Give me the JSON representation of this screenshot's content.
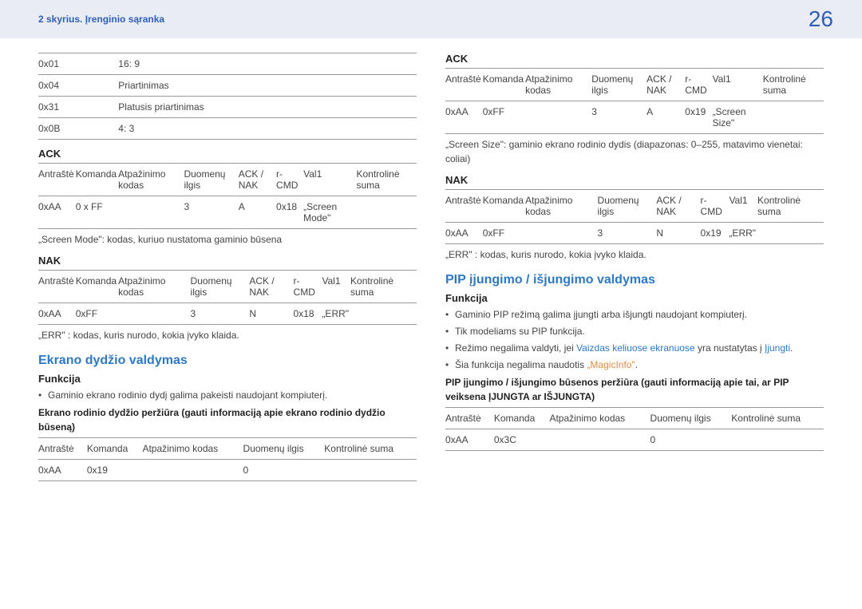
{
  "header": {
    "chapter": "2 skyrius. Įrenginio sąranka",
    "page": "26"
  },
  "left": {
    "modes_table": {
      "rows": [
        [
          "0x01",
          "16: 9"
        ],
        [
          "0x04",
          "Priartinimas"
        ],
        [
          "0x31",
          "Platusis priartinimas"
        ],
        [
          "0x0B",
          "4: 3"
        ]
      ]
    },
    "ack_heading": "ACK",
    "ack_table": {
      "head": [
        "Antraštė",
        "Komanda",
        "Atpažinimo kodas",
        "Duomenų ilgis",
        "ACK / NAK",
        "r-CMD",
        "Val1",
        "Kontrolinė suma"
      ],
      "row": [
        "0xAA",
        "0 x FF",
        "",
        "3",
        "A",
        "0x18",
        "„Screen Mode\"",
        ""
      ]
    },
    "screen_mode_text": "„Screen Mode\": kodas, kuriuo nustatoma gaminio būsena",
    "nak_heading": "NAK",
    "nak_table": {
      "head": [
        "Antraštė",
        "Komanda",
        "Atpažinimo kodas",
        "Duomenų ilgis",
        "ACK / NAK",
        "r-CMD",
        "Val1",
        "Kontrolinė suma"
      ],
      "row": [
        "0xAA",
        "0xFF",
        "",
        "3",
        "N",
        "0x18",
        "„ERR\"",
        ""
      ]
    },
    "err_text": "„ERR\" : kodas, kuris nurodo, kokia įvyko klaida.",
    "section_heading": "Ekrano dydžio valdymas",
    "func_heading": "Funkcija",
    "func_bullet": "Gaminio ekrano rodinio dydį galima pakeisti naudojant kompiuterį.",
    "view_text": "Ekrano rodinio dydžio peržiūra (gauti informaciją apie ekrano rodinio dydžio būseną)",
    "view_table": {
      "head": [
        "Antraštė",
        "Komanda",
        "Atpažinimo kodas",
        "Duomenų ilgis",
        "Kontrolinė suma"
      ],
      "row": [
        "0xAA",
        "0x19",
        "",
        "0",
        ""
      ]
    }
  },
  "right": {
    "ack_heading": "ACK",
    "ack_table": {
      "head": [
        "Antraštė",
        "Komanda",
        "Atpažinimo kodas",
        "Duomenų ilgis",
        "ACK / NAK",
        "r-CMD",
        "Val1",
        "Kontrolinė suma"
      ],
      "row": [
        "0xAA",
        "0xFF",
        "",
        "3",
        "A",
        "0x19",
        "„Screen Size\"",
        ""
      ]
    },
    "screen_size_text": "„Screen Size\": gaminio ekrano rodinio dydis (diapazonas: 0–255, matavimo vienetai: coliai)",
    "nak_heading": "NAK",
    "nak_table": {
      "head": [
        "Antraštė",
        "Komanda",
        "Atpažinimo kodas",
        "Duomenų ilgis",
        "ACK / NAK",
        "r-CMD",
        "Val1",
        "Kontrolinė suma"
      ],
      "row": [
        "0xAA",
        "0xFF",
        "",
        "3",
        "N",
        "0x19",
        "„ERR\"",
        ""
      ]
    },
    "err_text": "„ERR\" : kodas, kuris nurodo, kokia įvyko klaida.",
    "section_heading": "PIP įjungimo / išjungimo valdymas",
    "func_heading": "Funkcija",
    "func_bullets": [
      "Gaminio PIP režimą galima įjungti arba išjungti naudojant kompiuterį.",
      "Tik modeliams su PIP funkcija."
    ],
    "bullet3_pre": "Režimo negalima valdyti, jei ",
    "bullet3_link1": "Vaizdas keliuose ekranuose",
    "bullet3_mid": " yra nustatytas į ",
    "bullet3_link2": "Įjungti",
    "bullet3_post": ".",
    "bullet4_pre": "Šia funkcija negalima naudotis ",
    "bullet4_link": "„MagicInfo\"",
    "bullet4_post": ".",
    "view_text": "PIP įjungimo / išjungimo būsenos peržiūra (gauti informaciją apie tai, ar PIP veiksena ĮJUNGTA ar IŠJUNGTA)",
    "view_table": {
      "head": [
        "Antraštė",
        "Komanda",
        "Atpažinimo kodas",
        "Duomenų ilgis",
        "Kontrolinė suma"
      ],
      "row": [
        "0xAA",
        "0x3C",
        "",
        "0",
        ""
      ]
    }
  }
}
